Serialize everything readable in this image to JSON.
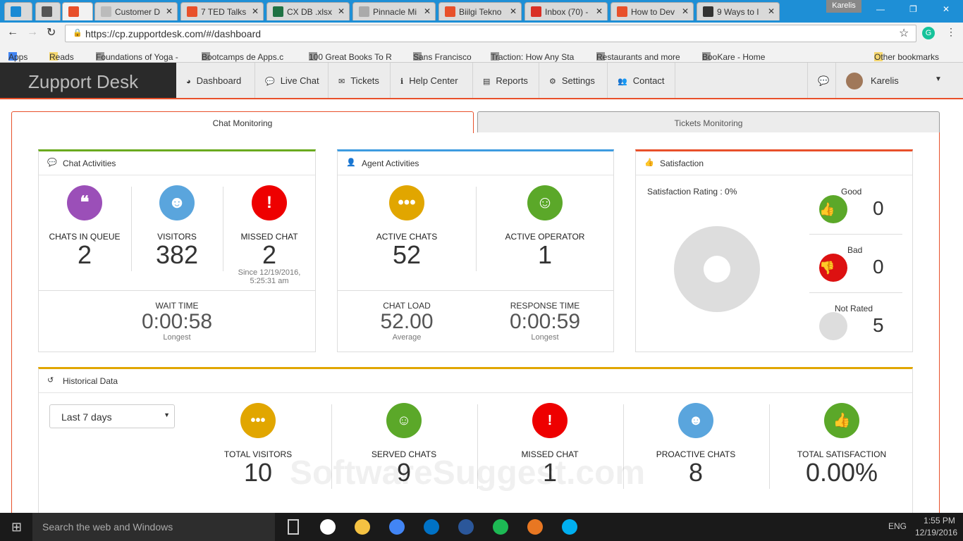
{
  "browser": {
    "tabs": [
      {
        "label": "",
        "color": "#1a8ad4"
      },
      {
        "label": "",
        "color": "#555"
      },
      {
        "label": "",
        "color": "#e8502a"
      },
      {
        "label": "Customer D",
        "color": "#bbb"
      },
      {
        "label": "7 TED Talks",
        "color": "#e8502a"
      },
      {
        "label": "CX DB .xlsx",
        "color": "#1f7244"
      },
      {
        "label": "Pinnacle Mi",
        "color": "#aaa"
      },
      {
        "label": "Biilgi Tekno",
        "color": "#e8502a"
      },
      {
        "label": "Inbox (70) -",
        "color": "#d93025"
      },
      {
        "label": "How to Dev",
        "color": "#e8502a"
      },
      {
        "label": "9 Ways to I",
        "color": "#333"
      }
    ],
    "profile": "Karelis",
    "url": "https://cp.zupportdesk.com/#/dashboard",
    "bookmarks": [
      "Apps",
      "Reads",
      "Foundations of Yoga -",
      "Bootcamps de Apps.c",
      "100 Great Books To R",
      "Sans Francisco",
      "Traction: How Any Sta",
      "Restaurants and more",
      "BooKare - Home"
    ],
    "other_bookmarks": "Other bookmarks"
  },
  "app": {
    "logo": "Zupport Desk",
    "nav": [
      "Dashboard",
      "Live Chat",
      "Tickets",
      "Help Center",
      "Reports",
      "Settings",
      "Contact"
    ],
    "user": "Karelis",
    "accent": "#e8502a"
  },
  "tabs": {
    "chat": "Chat Monitoring",
    "tickets": "Tickets Monitoring"
  },
  "chat": {
    "title": "Chat Activities",
    "queue_label": "CHATS IN QUEUE",
    "queue": "2",
    "visitors_label": "VISITORS",
    "visitors": "382",
    "missed_label": "MISSED CHAT",
    "missed": "2",
    "since": "Since 12/19/2016,",
    "since_time": "5:25:31 am",
    "wait_label": "WAIT TIME",
    "wait": "0:00:58",
    "wait_sub": "Longest"
  },
  "agent": {
    "title": "Agent Activities",
    "active_chats_label": "ACTIVE CHATS",
    "active_chats": "52",
    "operator_label": "ACTIVE OPERATOR",
    "operator": "1",
    "load_label": "CHAT LOAD",
    "load": "52.00",
    "load_sub": "Average",
    "resp_label": "RESPONSE TIME",
    "resp": "0:00:59",
    "resp_sub": "Longest"
  },
  "satisfaction": {
    "title": "Satisfaction",
    "rating": "Satisfaction Rating : 0%",
    "good_label": "Good",
    "good": "0",
    "bad_label": "Bad",
    "bad": "0",
    "nr_label": "Not Rated",
    "nr": "5"
  },
  "historical": {
    "title": "Historical Data",
    "range": "Last 7 days",
    "items": [
      {
        "label": "TOTAL VISITORS",
        "value": "10",
        "color": "#e1a600",
        "icon": "•••"
      },
      {
        "label": "SERVED CHATS",
        "value": "9",
        "color": "#5ba829",
        "icon": "☺"
      },
      {
        "label": "MISSED CHAT",
        "value": "1",
        "color": "#e00",
        "icon": "!"
      },
      {
        "label": "PROACTIVE CHATS",
        "value": "8",
        "color": "#5aa5dd",
        "icon": "☻"
      },
      {
        "label": "TOTAL SATISFACTION",
        "value": "0.00%",
        "color": "#5ba829",
        "icon": "👍"
      }
    ]
  },
  "watermark": "SoftwareSuggest.com",
  "taskbar": {
    "search": "Search the web and Windows",
    "lang": "ENG",
    "time": "1:55 PM",
    "date": "12/19/2016"
  }
}
